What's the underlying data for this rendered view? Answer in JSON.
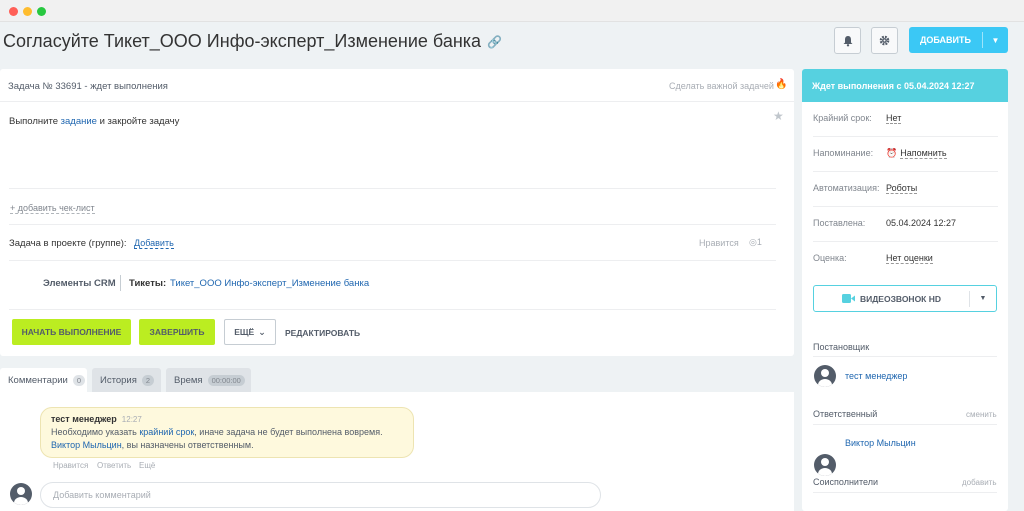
{
  "window": {
    "dot_colors": [
      "#ff5f57",
      "#febc2e",
      "#28c840"
    ]
  },
  "page": {
    "title": "Согласуйте Тикет_ООО Инфо-эксперт_Изменение банка"
  },
  "toolbar": {
    "add_label": "ДОБАВИТЬ"
  },
  "task": {
    "header": "Задача № 33691 - ждет выполнения",
    "make_important": "Сделать важной задачей",
    "desc_before": "Выполните ",
    "desc_link": "задание",
    "desc_after": " и закройте задачу",
    "add_checklist": "+ добавить чек-лист",
    "project_label": "Задача в проекте (группе):",
    "project_add": "Добавить",
    "likes_label": "Нравится",
    "views_count": "1",
    "crm_label": "Элементы CRM",
    "crm_type": "Тикеты:",
    "crm_link": "Тикет_ООО Инфо-эксперт_Изменение банка",
    "start_label": "НАЧАТЬ ВЫПОЛНЕНИЕ",
    "finish_label": "ЗАВЕРШИТЬ",
    "more_label": "ЕЩЁ",
    "edit_label": "РЕДАКТИРОВАТЬ"
  },
  "tabs": [
    {
      "label": "Комментарии",
      "badge": "0"
    },
    {
      "label": "История",
      "badge": "2"
    },
    {
      "label": "Время",
      "badge": "00:00:00"
    }
  ],
  "comment": {
    "author": "тест менеджер",
    "time": "12:27",
    "line1_before": "Необходимо указать ",
    "line1_link": "крайний срок",
    "line1_after": ", иначе задача не будет выполнена вовремя.",
    "line2_link": "Виктор Мыльцин",
    "line2_after": ", вы назначены ответственным.",
    "actions": [
      "Нравится",
      "Ответить",
      "Ещё"
    ],
    "input_placeholder": "Добавить комментарий"
  },
  "sidebar": {
    "status": "Ждет выполнения с 05.04.2024 12:27",
    "props": [
      {
        "key": "Крайний срок:",
        "value": "Нет"
      },
      {
        "key": "Напоминание:",
        "value": "Напомнить"
      },
      {
        "key": "Автоматизация:",
        "value": "Роботы"
      },
      {
        "key": "Поставлена:",
        "value": "05.04.2024 12:27"
      },
      {
        "key": "Оценка:",
        "value": "Нет оценки"
      }
    ],
    "video_label": "ВИДЕОЗВОНОК HD",
    "creator_title": "Постановщик",
    "creator_name": "тест менеджер",
    "responsible_title": "Ответственный",
    "responsible_change": "сменить",
    "responsible_name": "Виктор Мыльцин",
    "coexec_title": "Соисполнители",
    "coexec_add": "добавить"
  }
}
